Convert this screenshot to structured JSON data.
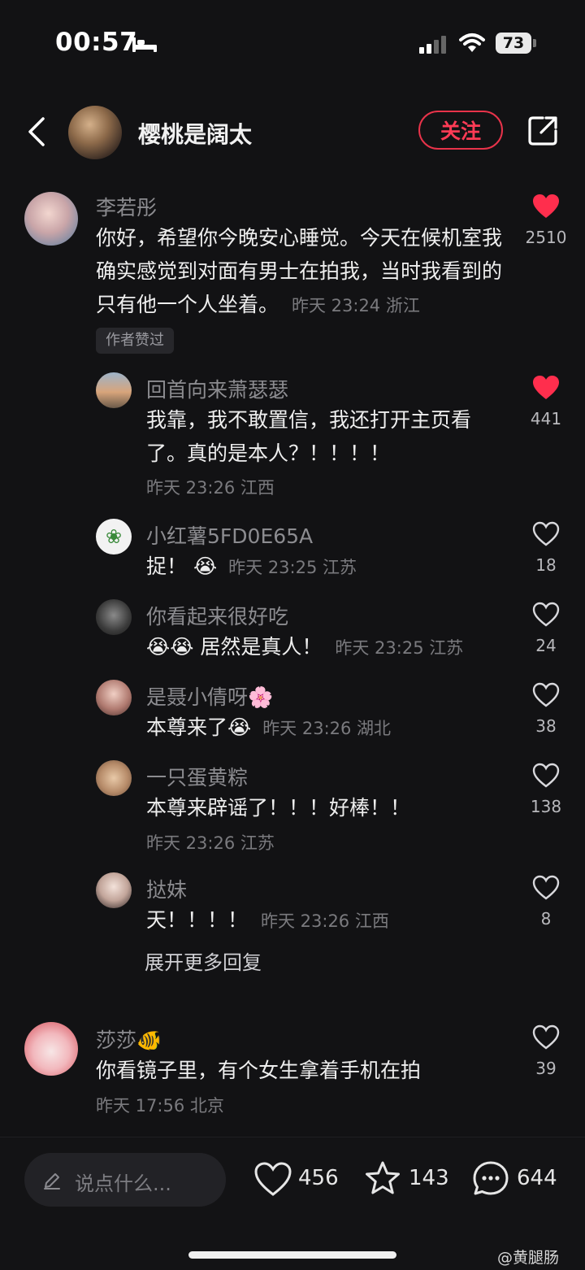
{
  "status": {
    "time": "00:57",
    "battery": "73"
  },
  "header": {
    "username": "樱桃是阔太",
    "follow_label": "关注"
  },
  "main_comment": {
    "name": "李若彤",
    "text": "你好，希望你今晚安心睡觉。今天在候机室我确实感觉到对面有男士在拍我，当时我看到的只有他一个人坐着。",
    "meta": "昨天 23:24 浙江",
    "likes": "2510",
    "author_tag": "作者赞过"
  },
  "replies": [
    {
      "name": "回首向来萧瑟瑟",
      "text": "我靠，我不敢置信，我还打开主页看了。真的是本人？！！！！",
      "meta": "昨天 23:26 江西",
      "likes": "441"
    },
    {
      "name": "小红薯5FD0E65A",
      "text": "捉！",
      "emoji": "😭",
      "meta": "昨天 23:25 江苏",
      "likes": "18"
    },
    {
      "name": "你看起来很好吃",
      "emoji": "😭😭",
      "text": "居然是真人！",
      "meta": "昨天 23:25 江苏",
      "likes": "24"
    },
    {
      "name": "是聂小倩呀",
      "name_emoji": "🌸",
      "text": "本尊来了",
      "emoji": "😭",
      "meta": "昨天 23:26 湖北",
      "likes": "38"
    },
    {
      "name": "一只蛋黄粽",
      "text": "本尊来辟谣了！！！好棒！！",
      "meta": "昨天 23:26 江苏",
      "likes": "138"
    },
    {
      "name": "挞妹",
      "text": "天！！！！",
      "meta": "昨天 23:26 江西",
      "likes": "8"
    }
  ],
  "expand_label": "展开更多回复",
  "second_comment": {
    "name": "莎莎",
    "name_emoji": "🐠",
    "text": "你看镜子里，有个女生拿着手机在拍",
    "meta": "昨天 17:56 北京",
    "likes": "39"
  },
  "bottom": {
    "input_placeholder": "说点什么...",
    "like_count": "456",
    "star_count": "143",
    "comment_count": "644"
  },
  "watermark": "@黄腿肠",
  "colors": {
    "background": "#121214",
    "accent": "#ff3b55",
    "liked_heart": "#ff2e4d"
  }
}
